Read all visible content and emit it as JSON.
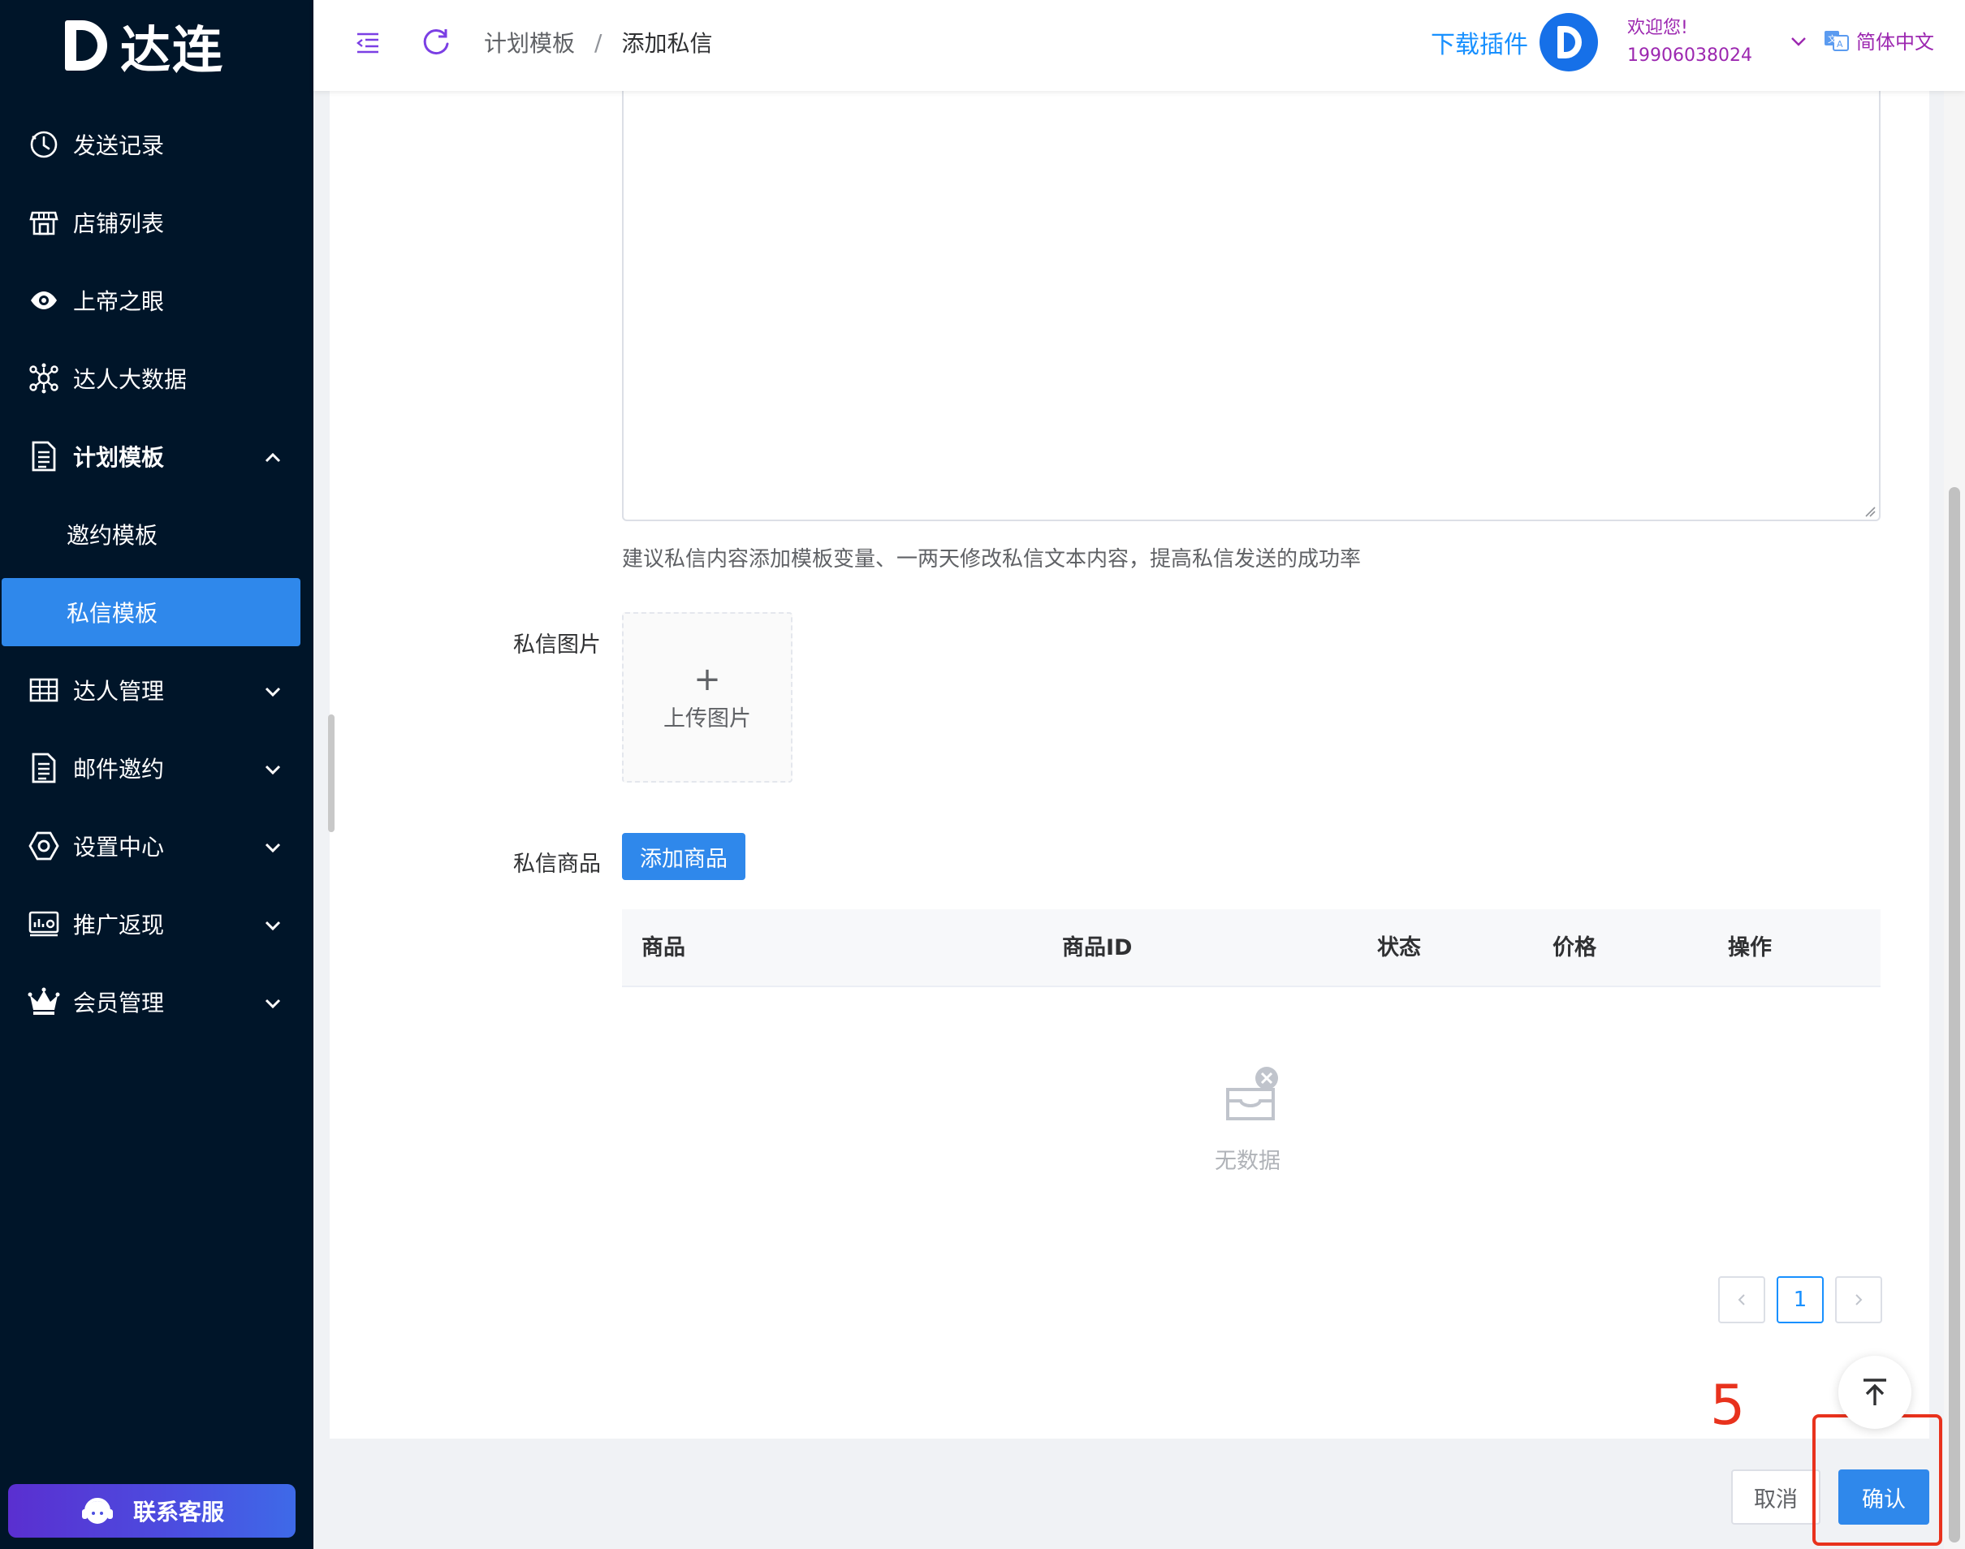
{
  "app": {
    "logo_text": "达连",
    "brand_color": "#2f88eb",
    "sidebar_bg": "#001529"
  },
  "sidebar": {
    "items": [
      {
        "label": "发送记录",
        "icon": "clock-icon"
      },
      {
        "label": "店铺列表",
        "icon": "store-icon"
      },
      {
        "label": "上帝之眼",
        "icon": "eye-icon"
      },
      {
        "label": "达人大数据",
        "icon": "network-icon"
      },
      {
        "label": "计划模板",
        "icon": "document-icon",
        "expanded": true
      },
      {
        "label": "达人管理",
        "icon": "table-icon"
      },
      {
        "label": "邮件邀约",
        "icon": "document-icon"
      },
      {
        "label": "设置中心",
        "icon": "settings-icon"
      },
      {
        "label": "推广返现",
        "icon": "dashboard-icon"
      },
      {
        "label": "会员管理",
        "icon": "crown-icon"
      }
    ],
    "submenu": [
      {
        "label": "邀约模板",
        "active": false
      },
      {
        "label": "私信模板",
        "active": true
      }
    ],
    "support_label": "联系客服"
  },
  "header": {
    "breadcrumb": [
      "计划模板",
      "添加私信"
    ],
    "breadcrumb_sep": "/",
    "download_label": "下载插件",
    "welcome": "欢迎您!",
    "phone": "19906038024",
    "language": "简体中文"
  },
  "form": {
    "hint": "建议私信内容添加模板变量、一两天修改私信文本内容，提高私信发送的成功率",
    "image_label": "私信图片",
    "upload_plus": "+",
    "upload_label": "上传图片",
    "product_label": "私信商品",
    "add_product_label": "添加商品"
  },
  "table": {
    "columns": [
      "商品",
      "商品ID",
      "状态",
      "价格",
      "操作"
    ],
    "rows": [],
    "empty_text": "无数据"
  },
  "pagination": {
    "current_page": "1"
  },
  "actions": {
    "cancel_label": "取消",
    "confirm_label": "确认",
    "step_number": "5"
  }
}
